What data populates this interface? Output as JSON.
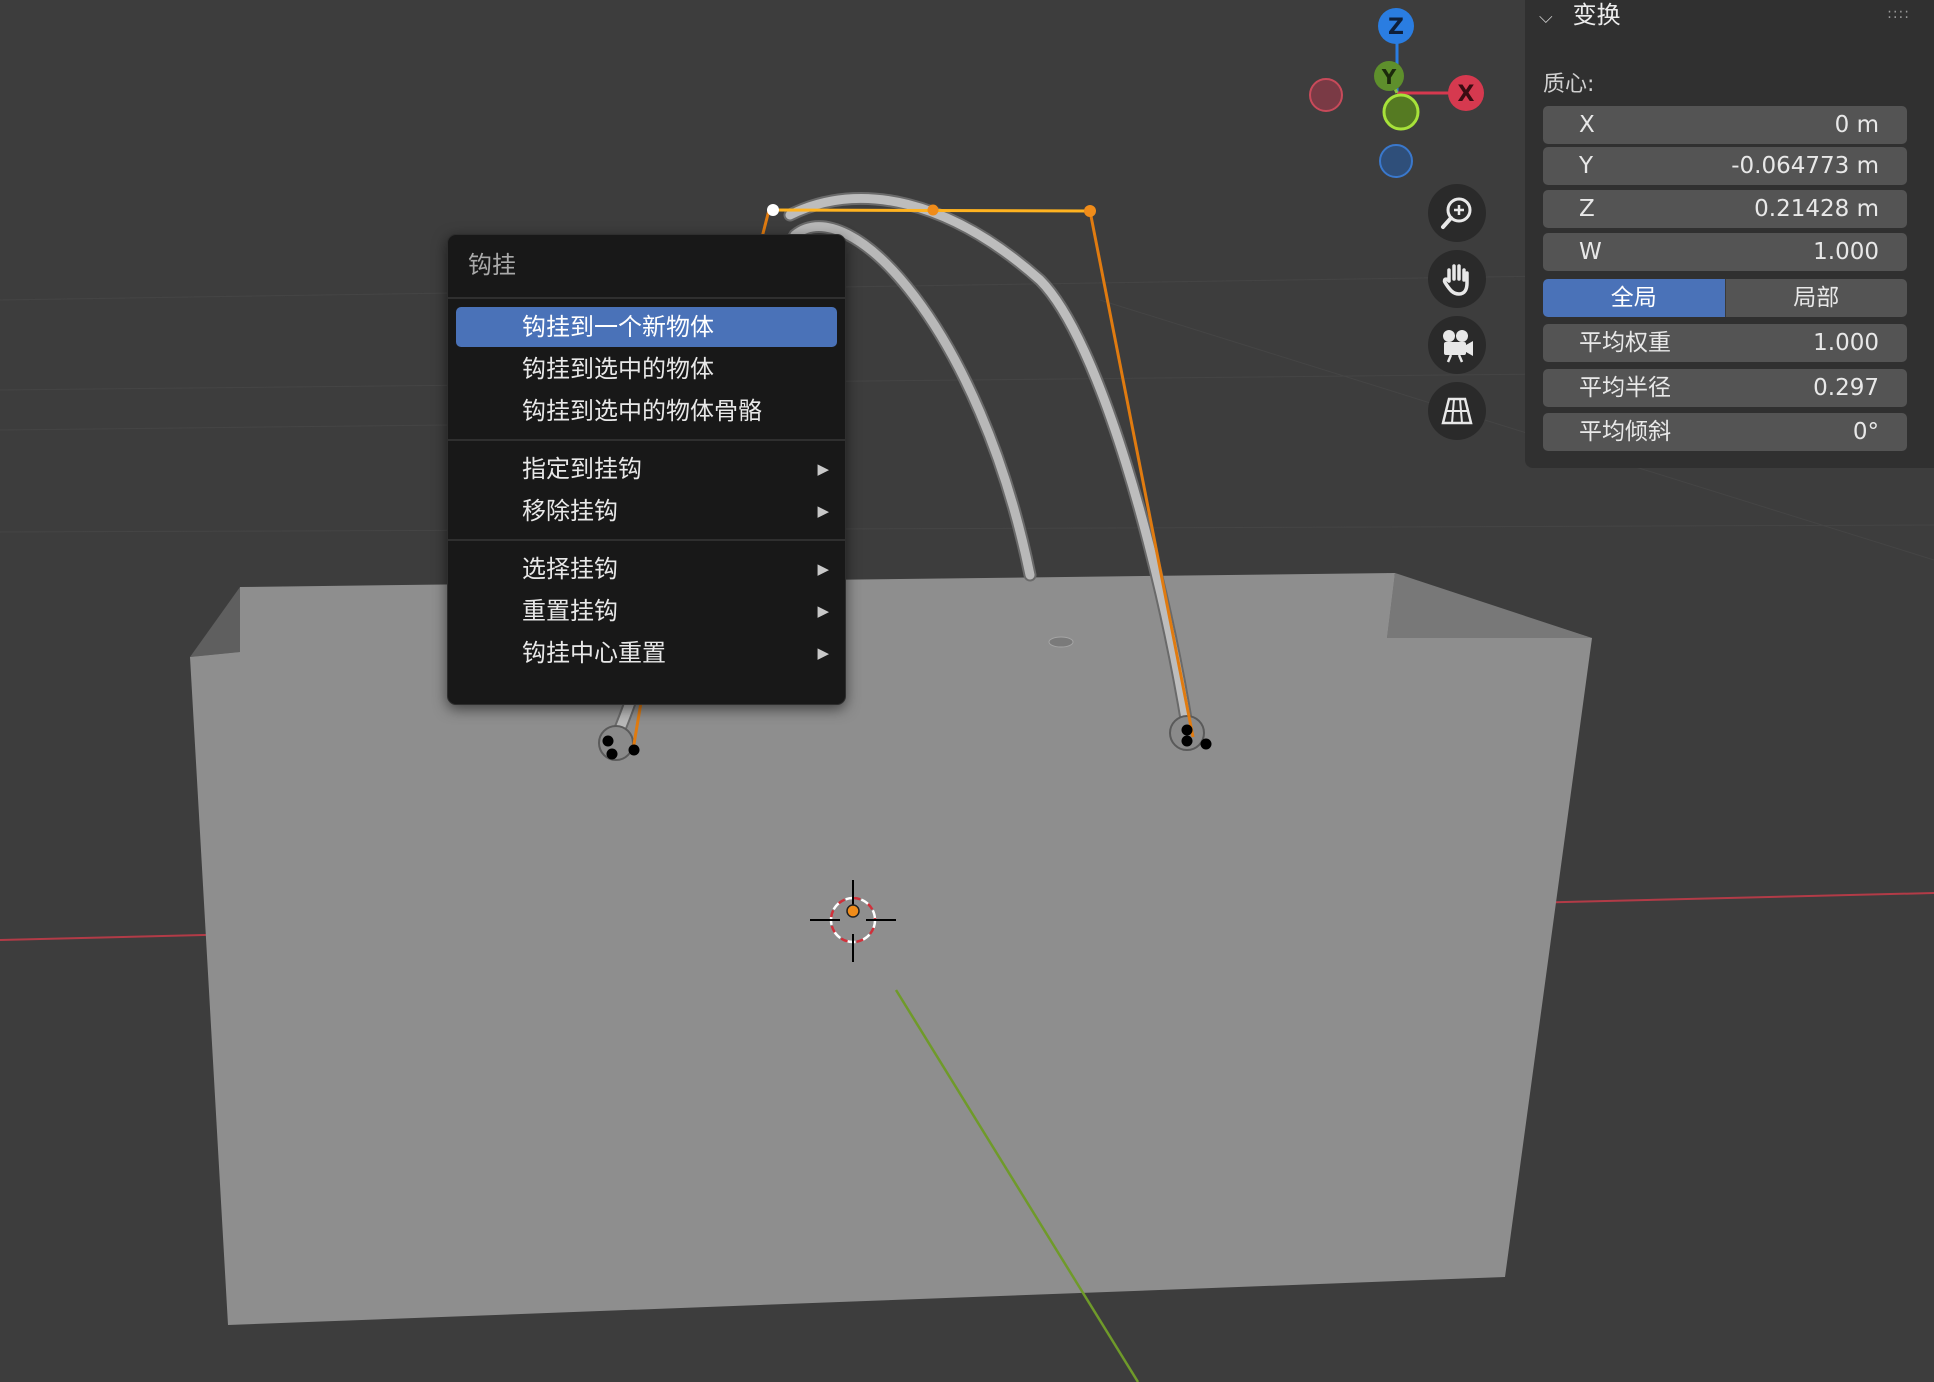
{
  "menu": {
    "title": "钩挂",
    "groups": [
      [
        {
          "label": "钩挂到一个新物体",
          "active": true,
          "submenu": false
        },
        {
          "label": "钩挂到选中的物体",
          "active": false,
          "submenu": false
        },
        {
          "label": "钩挂到选中的物体骨骼",
          "active": false,
          "submenu": false
        }
      ],
      [
        {
          "label": "指定到挂钩",
          "active": false,
          "submenu": true
        },
        {
          "label": "移除挂钩",
          "active": false,
          "submenu": true
        }
      ],
      [
        {
          "label": "选择挂钩",
          "active": false,
          "submenu": true
        },
        {
          "label": "重置挂钩",
          "active": false,
          "submenu": true
        },
        {
          "label": "钩挂中心重置",
          "active": false,
          "submenu": true
        }
      ]
    ]
  },
  "gizmo": {
    "z": "Z",
    "y": "Y",
    "x": "X"
  },
  "nav_tools": [
    "zoom-icon",
    "pan-hand-icon",
    "camera-view-icon",
    "perspective-grid-icon"
  ],
  "panel": {
    "title": "变换",
    "section": "质心:",
    "fields": {
      "x": {
        "label": "X",
        "value": "0 m"
      },
      "y": {
        "label": "Y",
        "value": "-0.064773 m"
      },
      "z": {
        "label": "Z",
        "value": "0.21428 m"
      },
      "w": {
        "label": "W",
        "value": "1.000"
      },
      "avg_weight": {
        "label": "平均权重",
        "value": "1.000"
      },
      "avg_radius": {
        "label": "平均半径",
        "value": "0.297"
      },
      "avg_tilt": {
        "label": "平均倾斜",
        "value": "0°"
      }
    },
    "space_toggle": {
      "global": "全局",
      "local": "局部",
      "selected": "global"
    }
  },
  "colors": {
    "accent": "#4a72b8",
    "selection": "#f08c1a",
    "axis_x": "#d6394f",
    "axis_y": "#8cc63f",
    "axis_z": "#2a7de1",
    "background": "#3d3d3d"
  }
}
